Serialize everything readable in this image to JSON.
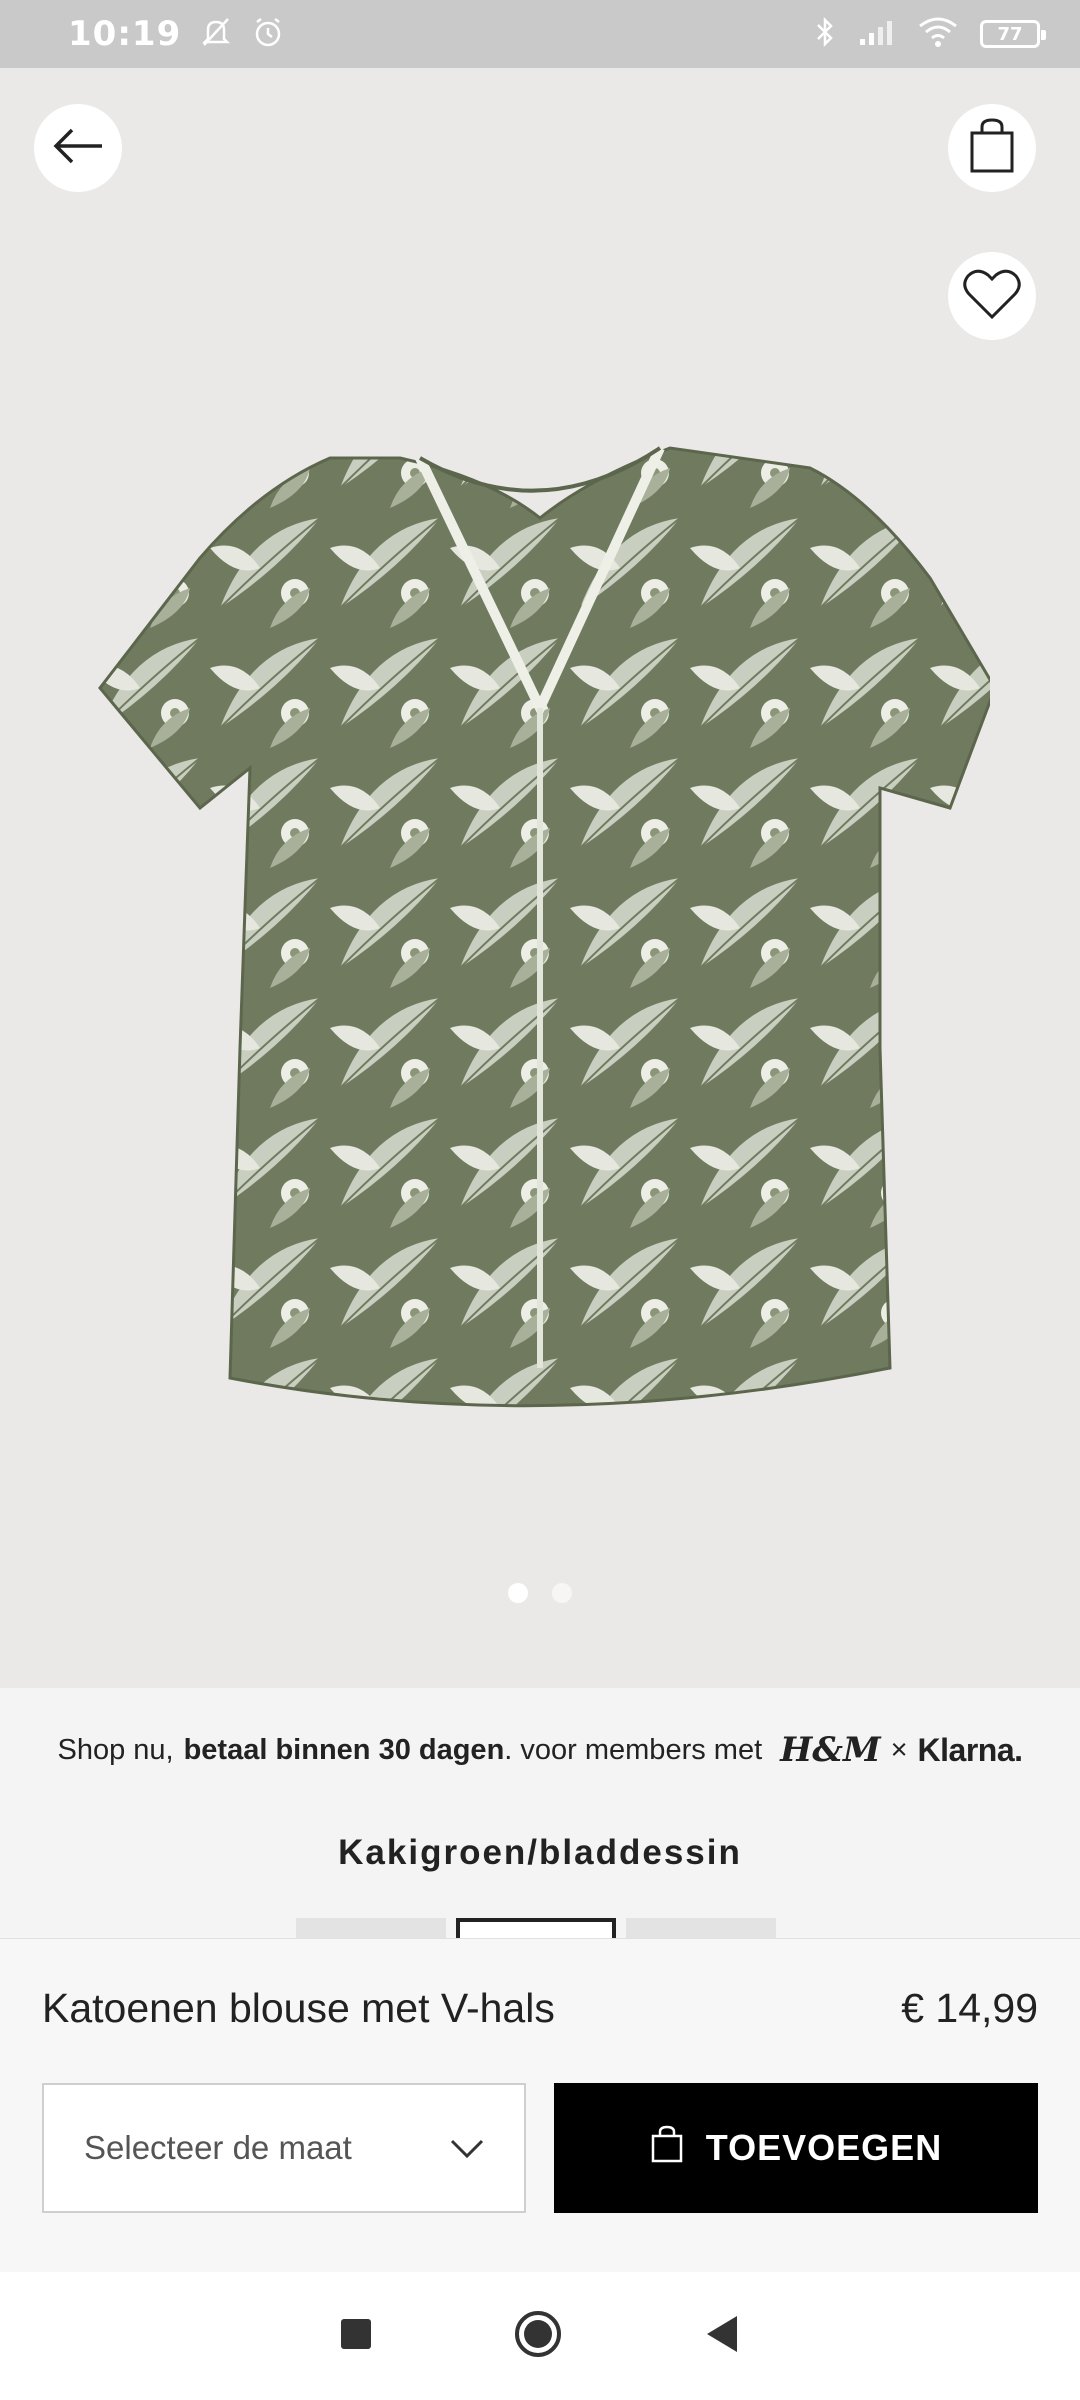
{
  "status_bar": {
    "time": "10:19",
    "battery": "77",
    "icons": [
      "bell-off-icon",
      "alarm-icon",
      "bluetooth-icon",
      "signal-icon",
      "wifi-icon",
      "battery-icon"
    ]
  },
  "header": {
    "back_icon": "arrow-left-icon",
    "bag_icon": "shopping-bag-icon",
    "favorite_icon": "heart-icon"
  },
  "gallery": {
    "image_count": 2,
    "active_index": 0
  },
  "promo": {
    "prefix": "Shop nu,",
    "bold": "betaal binnen 30 dagen",
    "suffix": ". voor members met",
    "hm_logo": "H&M",
    "times": "×",
    "klarna_logo": "Klarna."
  },
  "product": {
    "color_name": "Kakigroen/bladdessin",
    "name": "Katoenen blouse met V-hals",
    "price": "€ 14,99"
  },
  "actions": {
    "size_placeholder": "Selecteer de maat",
    "add_label": "TOEVOEGEN"
  },
  "colors": {
    "accent": "#000000",
    "hero_bg": "#ebe9e7",
    "shirt_base": "#6f7a5e"
  }
}
